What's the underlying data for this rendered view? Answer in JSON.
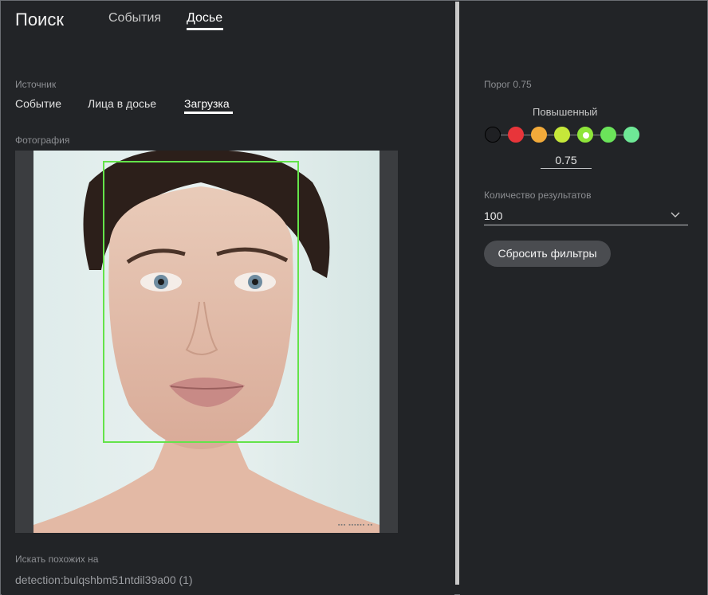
{
  "header": {
    "app_title": "Поиск",
    "tabs": [
      {
        "label": "События",
        "active": false
      },
      {
        "label": "Досье",
        "active": true
      }
    ]
  },
  "source": {
    "label": "Источник",
    "tabs": [
      {
        "label": "Событие",
        "active": false
      },
      {
        "label": "Лица в досье",
        "active": false
      },
      {
        "label": "Загрузка",
        "active": true
      }
    ]
  },
  "photo": {
    "label": "Фотография",
    "face_box_color": "#64e34a"
  },
  "similar": {
    "label": "Искать похожих на",
    "value": "detection:bulqshbm51ntdil39a00 (1)"
  },
  "threshold": {
    "label": "Порог 0.75",
    "level_name": "Повышенный",
    "value": "0.75",
    "levels": [
      {
        "color": "#1f2023",
        "border": "#000000",
        "selected": false
      },
      {
        "color": "#e8353a",
        "border": "#e8353a",
        "selected": false
      },
      {
        "color": "#f2aa3a",
        "border": "#f2aa3a",
        "selected": false
      },
      {
        "color": "#c6e83a",
        "border": "#c6e83a",
        "selected": false
      },
      {
        "color": "#8ee53a",
        "border": "#8ee53a",
        "selected": true
      },
      {
        "color": "#6be35a",
        "border": "#6be35a",
        "selected": false
      },
      {
        "color": "#6ee896",
        "border": "#6ee896",
        "selected": false
      }
    ]
  },
  "results": {
    "label": "Количество результатов",
    "value": "100",
    "icon": "chevron-down-icon"
  },
  "reset_button": {
    "label": "Сбросить фильтры"
  },
  "expand_icon": "chevron-right-icon"
}
